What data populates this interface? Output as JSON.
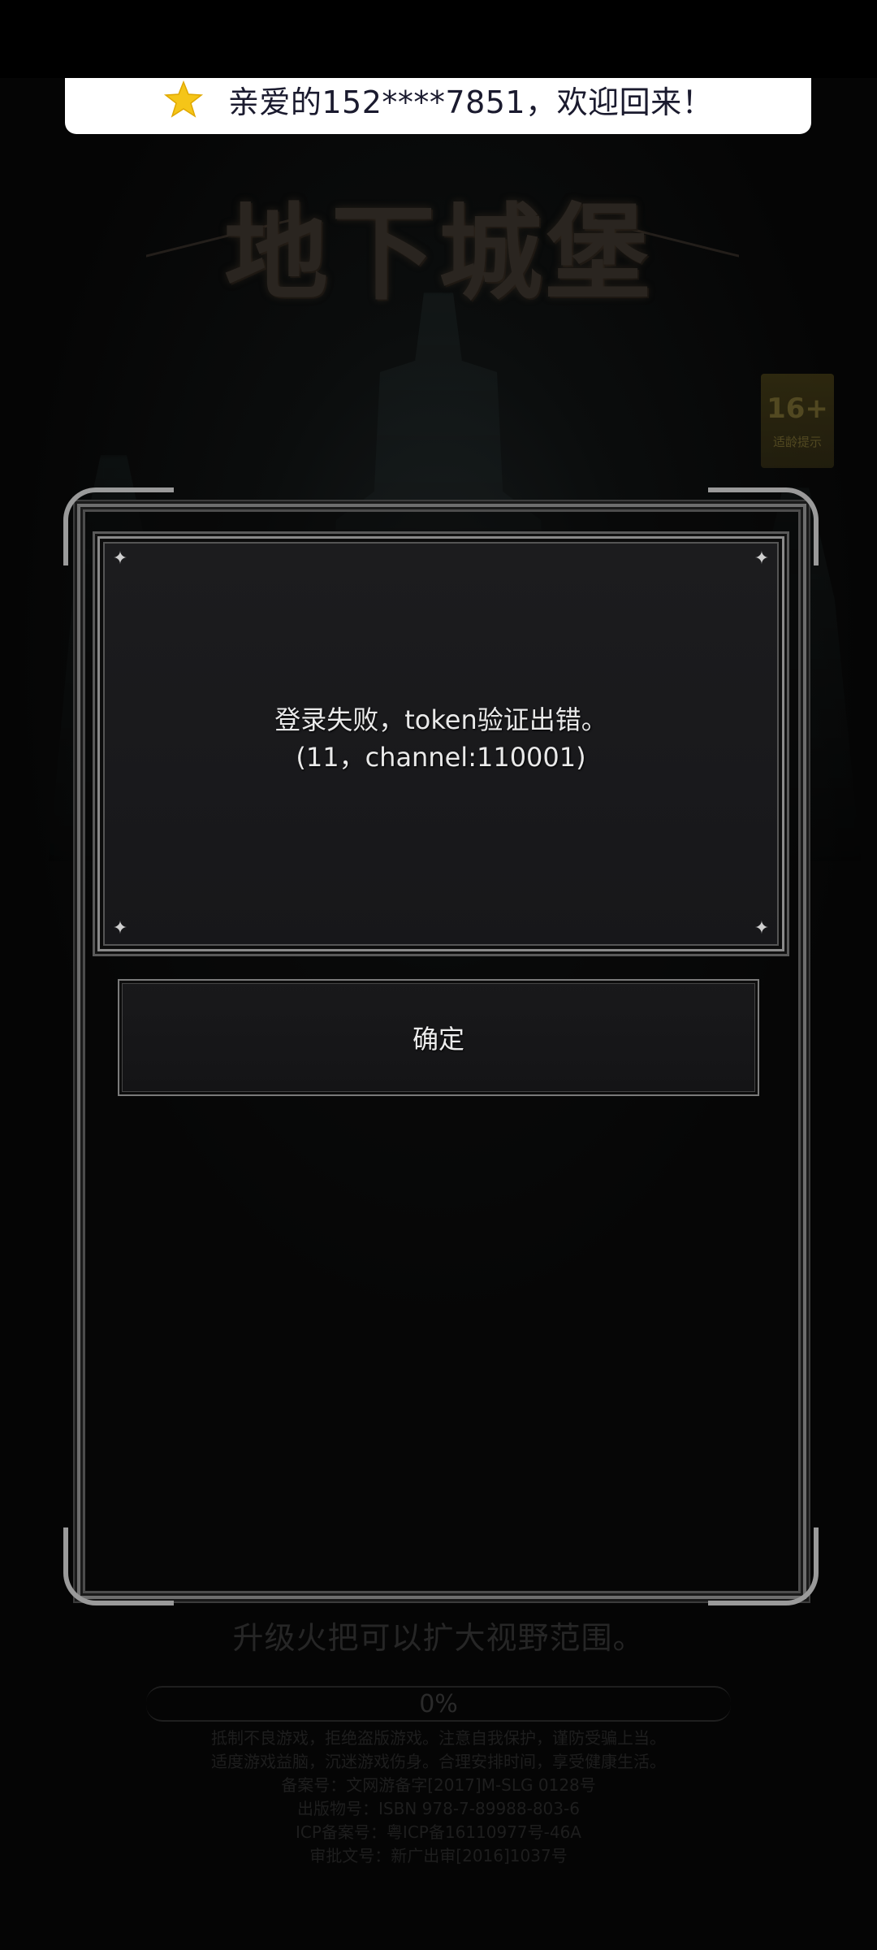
{
  "toast": {
    "icon": "star-icon",
    "text": "亲爱的152****7851，欢迎回来！"
  },
  "logo": {
    "text": "地下城堡"
  },
  "age_badge": {
    "age": "16+",
    "label": "适龄提示"
  },
  "dialog": {
    "message_line1": "登录失败，token验证出错。",
    "message_line2": "(11，channel:110001)",
    "confirm_label": "确定"
  },
  "loading": {
    "tip": "升级火把可以扩大视野范围。",
    "progress_text": "0%",
    "progress_value": 0
  },
  "legal": {
    "line1": "抵制不良游戏，拒绝盗版游戏。注意自我保护，谨防受骗上当。",
    "line2": "适度游戏益脑，沉迷游戏伤身。合理安排时间，享受健康生活。",
    "line3": "备案号：文网游备字[2017]M-SLG 0128号",
    "line4": "出版物号：ISBN 978-7-89988-803-6",
    "line5": "ICP备案号：粤ICP备16110977号-46A",
    "line6": "审批文号：新广出审[2016]1037号"
  },
  "colors": {
    "toast_bg": "#ffffff",
    "toast_text": "#1a1a2e",
    "star": "#f5c518",
    "dialog_bg": "#1c1c1e",
    "dialog_text": "#e9e9e9"
  }
}
